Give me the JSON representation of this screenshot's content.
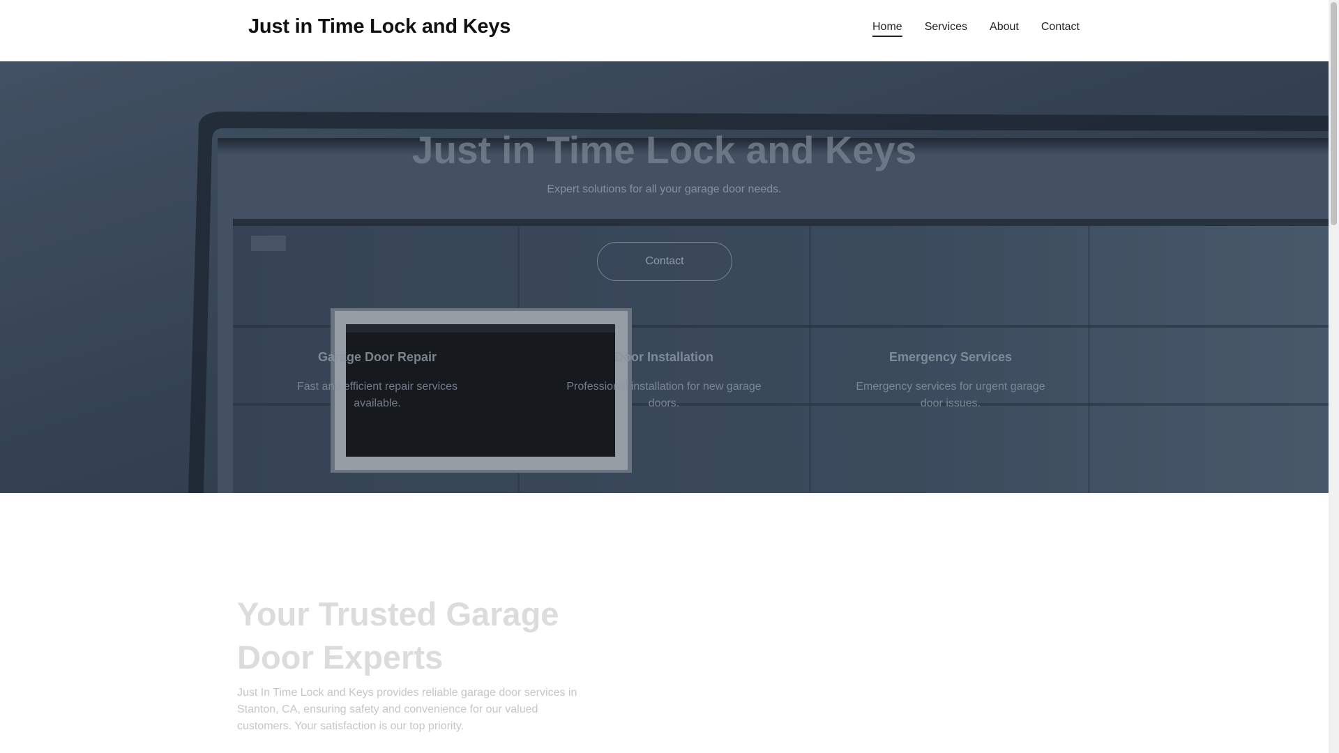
{
  "header": {
    "brand": "Just in Time Lock and Keys",
    "nav": [
      {
        "label": "Home",
        "active": true
      },
      {
        "label": "Services",
        "active": false
      },
      {
        "label": "About",
        "active": false
      },
      {
        "label": "Contact",
        "active": false
      }
    ]
  },
  "hero": {
    "title": "Just in Time Lock and Keys",
    "subtitle": "Expert solutions for all your garage door needs.",
    "button_label": "Contact",
    "features": [
      {
        "title": "Garage Door Repair",
        "text": "Fast and efficient repair services available."
      },
      {
        "title": "Door Installation",
        "text": "Professional installation for new garage doors."
      },
      {
        "title": "Emergency Services",
        "text": "Emergency services for urgent garage door issues."
      }
    ]
  },
  "about": {
    "title": "Your Trusted Garage Door Experts",
    "text": "Just In Time Lock and Keys provides reliable garage door services in Stanton, CA, ensuring safety and convenience for our valued customers. Your satisfaction is our top priority."
  },
  "colors": {
    "hero_tint": "#2f3b4b",
    "text_dark": "#111111",
    "muted_heading": "#dcdcdc"
  }
}
